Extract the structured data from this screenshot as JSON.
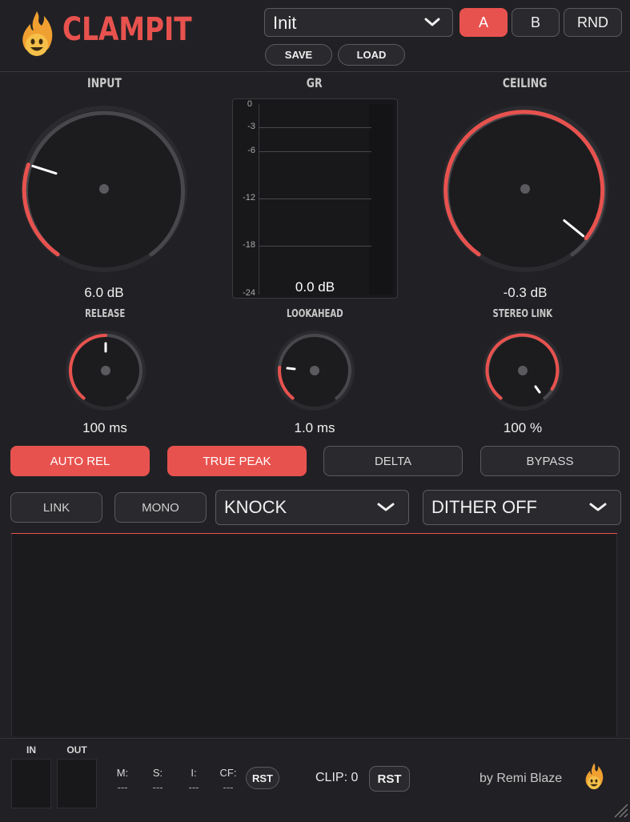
{
  "header": {
    "title": "CLAMPIT",
    "preset_name": "Init",
    "save_label": "SAVE",
    "load_label": "LOAD",
    "ab_a_label": "A",
    "ab_b_label": "B",
    "rnd_label": "RND"
  },
  "knobs": {
    "input": {
      "label": "INPUT",
      "value": "6.0 dB",
      "level": 0.15
    },
    "ceiling": {
      "label": "CEILING",
      "value": "-0.3 dB",
      "level": 0.85
    },
    "release": {
      "label": "RELEASE",
      "value": "100 ms",
      "level": 0.5
    },
    "lookahead": {
      "label": "LOOKAHEAD",
      "value": "1.0 ms",
      "level": 0.2
    },
    "stereo_link": {
      "label": "STEREO LINK",
      "value": "100 %",
      "level": 0.85
    }
  },
  "gr_meter": {
    "label": "GR",
    "scale": [
      "0",
      "-3",
      "-6",
      "-12",
      "-18",
      "-24"
    ],
    "value": "0.0 dB"
  },
  "toggles": {
    "auto_rel": "AUTO REL",
    "true_peak": "TRUE PEAK",
    "delta": "DELTA",
    "bypass": "BYPASS",
    "link": "LINK",
    "mono": "MONO"
  },
  "dropdowns": {
    "mode": "KNOCK",
    "dither": "DITHER OFF"
  },
  "footer": {
    "in_label": "IN",
    "out_label": "OUT",
    "stats": [
      {
        "label": "M:",
        "value": "---"
      },
      {
        "label": "S:",
        "value": "---"
      },
      {
        "label": "I:",
        "value": "---"
      },
      {
        "label": "CF:",
        "value": "---"
      }
    ],
    "rst_label": "RST",
    "clip_label": "CLIP: 0",
    "clip_rst_label": "RST",
    "credit": "by Remi Blaze"
  },
  "colors": {
    "accent": "#e8524e",
    "background": "#212125",
    "panel": "#1b1b1e"
  }
}
